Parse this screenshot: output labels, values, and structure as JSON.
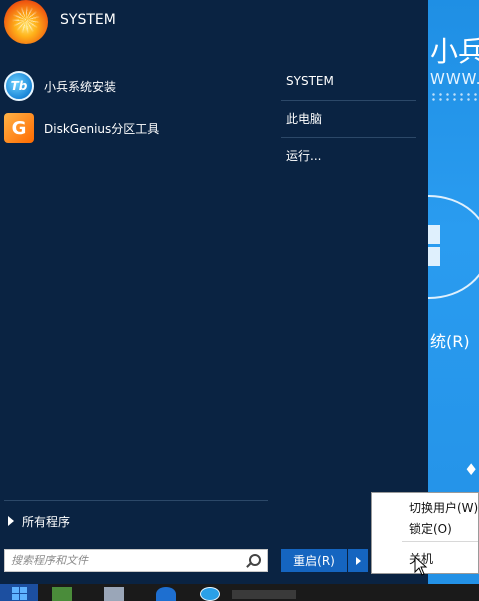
{
  "user": {
    "name": "SYSTEM"
  },
  "pinned_apps": [
    {
      "label": "小兵系统安装",
      "icon": "xiaobing-install-icon",
      "icon_glyph": "Tb"
    },
    {
      "label": "DiskGenius分区工具",
      "icon": "diskgenius-icon",
      "icon_glyph": "G"
    }
  ],
  "right_pane": {
    "items": [
      {
        "label": "SYSTEM"
      },
      {
        "label": "此电脑"
      },
      {
        "label": "运行..."
      }
    ]
  },
  "all_programs": {
    "label": "所有程序",
    "icon": "chevron-right-icon"
  },
  "search": {
    "placeholder": "搜索程序和文件",
    "value": "",
    "icon": "search-icon"
  },
  "power": {
    "button_label": "重启(R)",
    "arrow_icon": "chevron-right-icon",
    "menu_items": [
      {
        "label": "切换用户(W)"
      },
      {
        "label": "锁定(O)"
      },
      {
        "label": "关机"
      }
    ]
  },
  "wallpaper": {
    "title": "小兵",
    "url": "WWW.X",
    "system_label": "统(R)"
  },
  "colors": {
    "menu_bg": "#0a2342",
    "accent_button": "#1565c0",
    "wallpaper": "#2a9cf0",
    "taskbar": "#1a1a1a"
  }
}
